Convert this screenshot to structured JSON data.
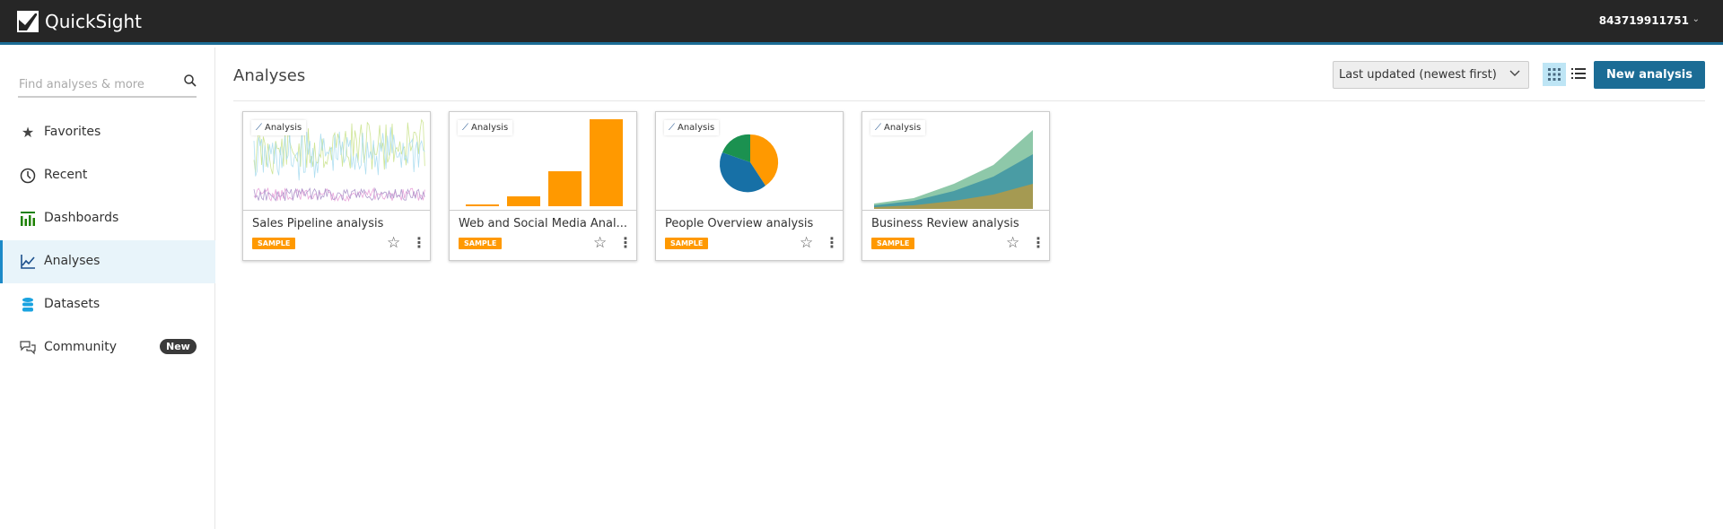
{
  "header": {
    "brand": "QuickSight",
    "account": "843719911751"
  },
  "sidebar": {
    "search_placeholder": "Find analyses & more",
    "items": [
      {
        "label": "Favorites",
        "icon": "star-icon"
      },
      {
        "label": "Recent",
        "icon": "clock-icon"
      },
      {
        "label": "Dashboards",
        "icon": "bar-chart-icon"
      },
      {
        "label": "Analyses",
        "icon": "line-chart-icon",
        "active": true
      },
      {
        "label": "Datasets",
        "icon": "database-icon"
      },
      {
        "label": "Community",
        "icon": "chat-icon",
        "badge": "New"
      }
    ]
  },
  "main": {
    "title": "Analyses",
    "sort": "Last updated (newest first)",
    "new_button": "New analysis",
    "cards": [
      {
        "title": "Sales Pipeline analysis",
        "type": "Analysis",
        "badge": "SAMPLE",
        "thumbnail": "multi-line"
      },
      {
        "title": "Web and Social Media Anal...",
        "type": "Analysis",
        "badge": "SAMPLE",
        "thumbnail": "bar"
      },
      {
        "title": "People Overview analysis",
        "type": "Analysis",
        "badge": "SAMPLE",
        "thumbnail": "pie"
      },
      {
        "title": "Business Review analysis",
        "type": "Analysis",
        "badge": "SAMPLE",
        "thumbnail": "stacked-area"
      }
    ]
  },
  "colors": {
    "header": "#262626",
    "accent": "#1b6c95",
    "sample": "#ff9900",
    "active_bg": "#e8f4fa"
  }
}
